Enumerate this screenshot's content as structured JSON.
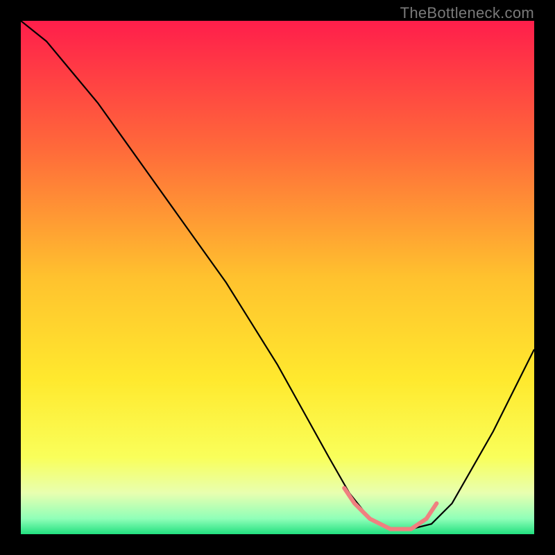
{
  "watermark": "TheBottleneck.com",
  "chart_data": {
    "type": "line",
    "title": "",
    "xlabel": "",
    "ylabel": "",
    "xlim": [
      0,
      100
    ],
    "ylim": [
      0,
      100
    ],
    "grid": false,
    "legend": false,
    "background_gradient": {
      "stops": [
        {
          "offset": 0.0,
          "color": "#ff1e4b"
        },
        {
          "offset": 0.25,
          "color": "#ff6a3a"
        },
        {
          "offset": 0.5,
          "color": "#ffc22e"
        },
        {
          "offset": 0.7,
          "color": "#ffe92e"
        },
        {
          "offset": 0.85,
          "color": "#f9ff5a"
        },
        {
          "offset": 0.92,
          "color": "#e8ffb0"
        },
        {
          "offset": 0.97,
          "color": "#8fffb8"
        },
        {
          "offset": 1.0,
          "color": "#22e07f"
        }
      ]
    },
    "series": [
      {
        "name": "bottleneck-curve",
        "color": "#000000",
        "width": 2.2,
        "x": [
          0,
          5,
          10,
          15,
          20,
          25,
          30,
          35,
          40,
          45,
          50,
          55,
          60,
          64,
          68,
          72,
          76,
          80,
          84,
          88,
          92,
          96,
          100
        ],
        "y": [
          100,
          96,
          90,
          84,
          77,
          70,
          63,
          56,
          49,
          41,
          33,
          24,
          15,
          8,
          3,
          1,
          1,
          2,
          6,
          13,
          20,
          28,
          36
        ]
      },
      {
        "name": "marker-band",
        "color": "#f08080",
        "width": 6,
        "cap": "round",
        "x": [
          63,
          65,
          68,
          72,
          76,
          79,
          81
        ],
        "y": [
          9,
          6,
          3,
          1,
          1,
          3,
          6
        ]
      }
    ]
  }
}
